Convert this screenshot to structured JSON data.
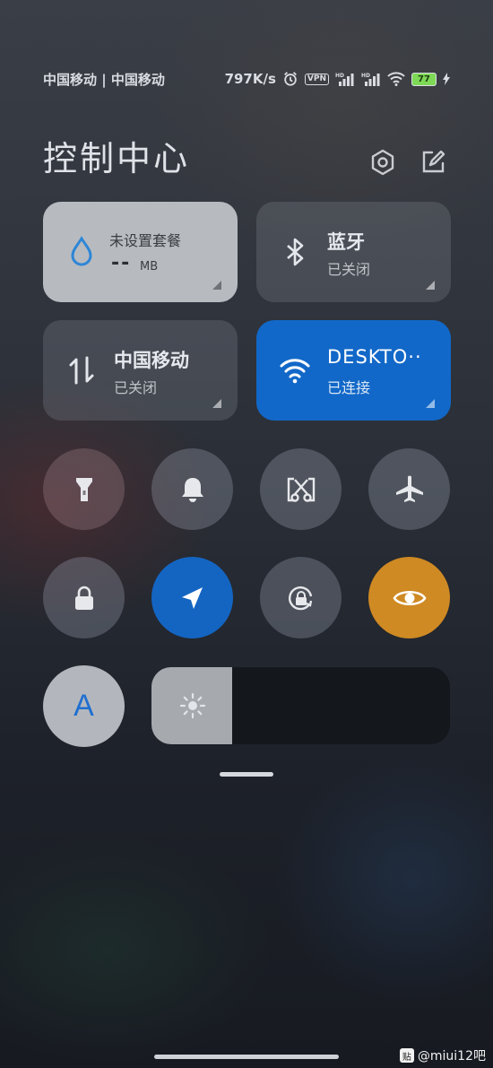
{
  "status_bar": {
    "carriers": "中国移动 | 中国移动",
    "speed": "797K/s",
    "vpn": "VPN",
    "battery": "77",
    "icons": [
      "alarm-icon",
      "vpn-icon",
      "signal-hd-icon",
      "signal-hd-icon",
      "wifi-icon",
      "battery-icon",
      "charging-icon"
    ]
  },
  "header": {
    "title": "控制中心",
    "icons": [
      "settings-icon",
      "edit-icon"
    ]
  },
  "cards": {
    "data": {
      "title": "未设置套餐",
      "value": "--",
      "unit": "MB",
      "icon": "water-drop-icon"
    },
    "bluetooth": {
      "title": "蓝牙",
      "status": "已关闭",
      "icon": "bluetooth-icon"
    },
    "mobile": {
      "title": "中国移动",
      "status": "已关闭",
      "icon": "mobile-data-icon"
    },
    "wifi": {
      "title": "DESKTO··",
      "status": "已连接",
      "icon": "wifi-icon"
    }
  },
  "toggles": [
    {
      "name": "flashlight",
      "icon": "flashlight-icon",
      "state": "off"
    },
    {
      "name": "mute",
      "icon": "bell-icon",
      "state": "off"
    },
    {
      "name": "screenshot",
      "icon": "scissors-icon",
      "state": "off"
    },
    {
      "name": "airplane",
      "icon": "airplane-icon",
      "state": "off"
    },
    {
      "name": "lock",
      "icon": "lock-icon",
      "state": "off"
    },
    {
      "name": "location",
      "icon": "location-arrow-icon",
      "state": "on"
    },
    {
      "name": "rotation",
      "icon": "rotation-lock-icon",
      "state": "off"
    },
    {
      "name": "reading",
      "icon": "eye-icon",
      "state": "on"
    }
  ],
  "auto_brightness": {
    "label": "A",
    "icon": "auto-brightness-icon"
  },
  "brightness": {
    "level": 0.27,
    "icon": "sun-icon"
  },
  "watermark": {
    "text": "@miui12吧",
    "badge": "贴"
  },
  "colors": {
    "accent_blue": "#1268c8",
    "accent_orange": "#cf8a23",
    "card_light": "#b7bbc0"
  }
}
